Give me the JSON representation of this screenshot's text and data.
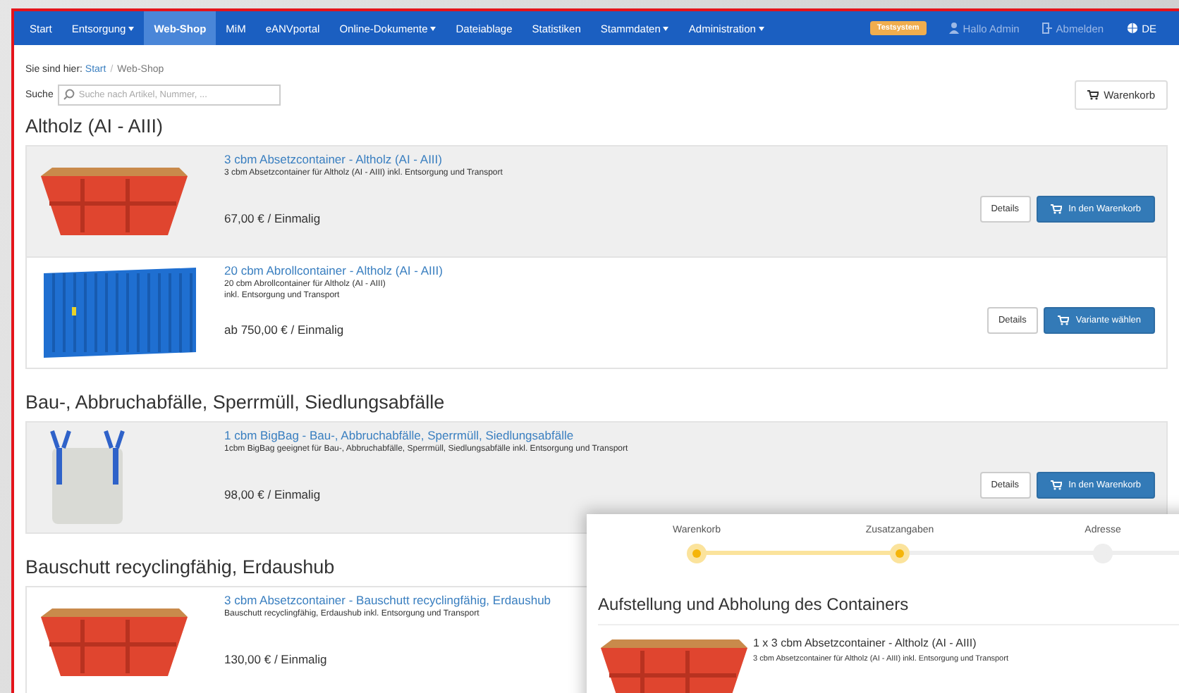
{
  "navbar": {
    "items": [
      {
        "label": "Start",
        "dropdown": false,
        "selected": false
      },
      {
        "label": "Entsorgung",
        "dropdown": true,
        "selected": false
      },
      {
        "label": "Web-Shop",
        "dropdown": false,
        "selected": true
      },
      {
        "label": "MiM",
        "dropdown": false,
        "selected": false
      },
      {
        "label": "eANVportal",
        "dropdown": false,
        "selected": false
      },
      {
        "label": "Online-Dokumente",
        "dropdown": true,
        "selected": false
      },
      {
        "label": "Dateiablage",
        "dropdown": false,
        "selected": false
      },
      {
        "label": "Statistiken",
        "dropdown": false,
        "selected": false
      },
      {
        "label": "Stammdaten",
        "dropdown": true,
        "selected": false
      },
      {
        "label": "Administration",
        "dropdown": true,
        "selected": false
      }
    ],
    "badge": "Testsystem",
    "user_menu": "Hallo Admin",
    "logout": "Abmelden",
    "language": "DE"
  },
  "breadcrumb": {
    "prefix": "Sie sind hier:",
    "separator": "/",
    "items": [
      "Start",
      "Web-Shop"
    ]
  },
  "search": {
    "label": "Suche",
    "placeholder": "Suche nach Artikel, Nummer, ..."
  },
  "cart_button": "Warenkorb",
  "categories": [
    {
      "title": "Altholz (AI - AIII)",
      "products": [
        {
          "kind": "skip",
          "highlighted": true,
          "title": "3 cbm Absetzcontainer - Altholz (AI - AIII)",
          "description": [
            "3 cbm Absetzcontainer für Altholz (AI - AIII) inkl. Entsorgung und Transport"
          ],
          "price": "67,00 € / Einmalig",
          "details": "Details",
          "action": "In den Warenkorb"
        },
        {
          "kind": "roll",
          "highlighted": false,
          "title": "20 cbm Abrollcontainer - Altholz (AI - AIII)",
          "description": [
            "20 cbm Abrollcontainer für Altholz (AI - AIII)",
            "inkl. Entsorgung und Transport"
          ],
          "price": "ab 750,00 € / Einmalig",
          "details": "Details",
          "action": "Variante wählen"
        }
      ]
    },
    {
      "title": "Bau-, Abbruchabfälle, Sperrmüll, Siedlungsabfälle",
      "products": [
        {
          "kind": "bigbag",
          "highlighted": true,
          "title": "1 cbm BigBag - Bau-, Abbruchabfälle, Sperrmüll, Siedlungsabfälle",
          "description": [
            "1cbm BigBag geeignet für Bau-, Abbruchabfälle, Sperrmüll, Siedlungsabfälle inkl. Entsorgung und Transport"
          ],
          "price": "98,00 € / Einmalig",
          "details": "Details",
          "action": "In den Warenkorb"
        }
      ]
    },
    {
      "title": "Bauschutt recyclingfähig, Erdaushub",
      "products": [
        {
          "kind": "skip",
          "highlighted": false,
          "title": "3 cbm Absetzcontainer - Bauschutt recyclingfähig, Erdaushub",
          "description": [
            "Bauschutt recyclingfähig, Erdaushub inkl. Entsorgung und Transport"
          ],
          "price": "130,00 € / Einmalig"
        }
      ]
    }
  ],
  "checkout_panel": {
    "steps": [
      {
        "label": "Warenkorb",
        "done": true
      },
      {
        "label": "Zusatzangaben",
        "done": true
      },
      {
        "label": "Adresse",
        "done": false
      }
    ],
    "heading": "Aufstellung und Abholung des Containers",
    "item": {
      "kind": "skip",
      "title": "1 x 3 cbm Absetzcontainer - Altholz (AI - AIII)",
      "description": "3 cbm Absetzcontainer für Altholz (AI - AIII) inkl. Entsorgung und Transport"
    }
  }
}
